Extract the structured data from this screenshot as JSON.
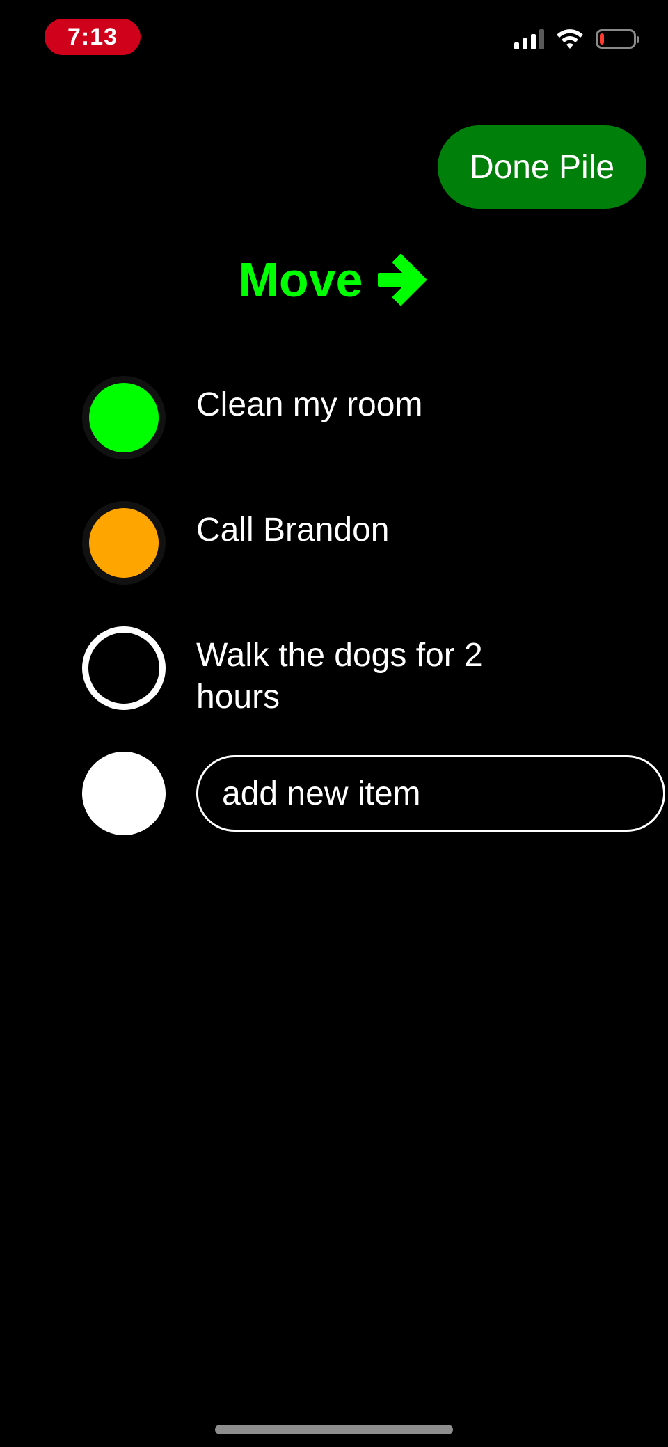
{
  "status_bar": {
    "time": "7:13",
    "time_pill_color": "#d0021b",
    "icons": [
      "signal-icon",
      "wifi-icon",
      "battery-icon"
    ],
    "battery_level_color": "#ff3b30"
  },
  "header": {
    "done_pile_label": "Done Pile",
    "done_pile_color": "#00800b"
  },
  "heading": {
    "title": "Move",
    "arrow_icon": "arrow-right-icon",
    "color": "#00ff00"
  },
  "tasks": [
    {
      "label": "Clean my room",
      "status_color": "#00ff00",
      "style": "filled"
    },
    {
      "label": "Call Brandon",
      "status_color": "#ffa500",
      "style": "filled"
    },
    {
      "label": "Walk the dogs for 2 hours",
      "status_color": "#ffffff",
      "style": "outline"
    }
  ],
  "new_item": {
    "placeholder": "add new item",
    "value": "",
    "circle_color": "#ffffff"
  }
}
